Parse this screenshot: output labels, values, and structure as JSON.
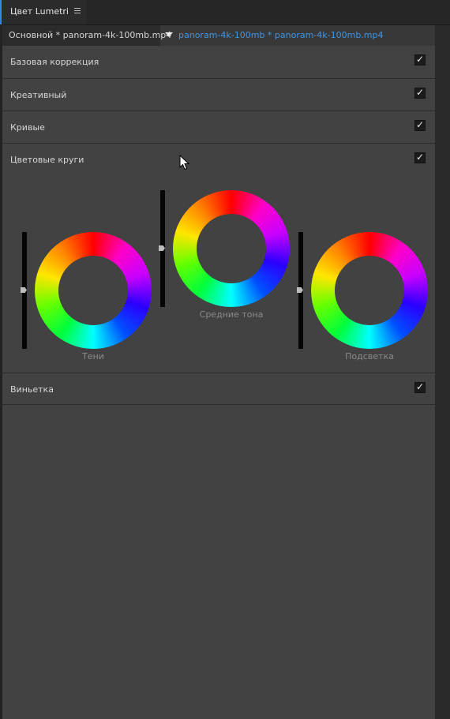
{
  "panel": {
    "title": "Цвет Lumetri",
    "menu_icon": "hamburger-menu-icon"
  },
  "clip_selector": {
    "master_clip": "Основной * panoram-4k-100mb.mp4",
    "dropdown_icon": "triangle-down-icon",
    "active_clip": "panoram-4k-100mb * panoram-4k-100mb.mp4"
  },
  "sections": [
    {
      "label": "Базовая коррекция",
      "checked": true
    },
    {
      "label": "Креативный",
      "checked": true
    },
    {
      "label": "Кривые",
      "checked": true
    },
    {
      "label": "Цветовые круги",
      "checked": true
    },
    {
      "label": "Виньетка",
      "checked": true
    }
  ],
  "checkmark": "✓",
  "wheels": [
    {
      "label": "Тени"
    },
    {
      "label": "Средние тона"
    },
    {
      "label": "Подсветка"
    }
  ],
  "colors": {
    "accent_blue": "#3f96e8",
    "panel_bg": "#424242"
  }
}
